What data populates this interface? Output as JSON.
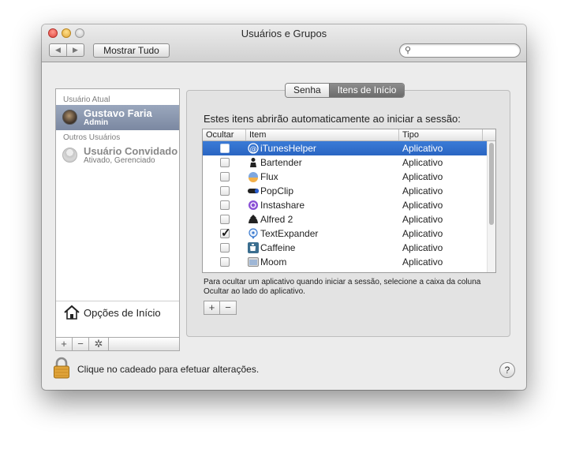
{
  "window": {
    "title": "Usuários e Grupos"
  },
  "toolbar": {
    "back_glyph": "◀",
    "forward_glyph": "▶",
    "show_all": "Mostrar Tudo",
    "search_placeholder": "",
    "search_icon": "magnifier-icon"
  },
  "sidebar": {
    "current_user_header": "Usuário Atual",
    "other_users_header": "Outros Usuários",
    "current_user": {
      "name": "Gustavo Faria",
      "role": "Admin",
      "selected": true
    },
    "guest_user": {
      "name": "Usuário Convidado",
      "status": "Ativado, Gerenciado"
    },
    "login_options": "Opções de Início",
    "tools": {
      "add": "+",
      "remove": "−",
      "action": "✲"
    }
  },
  "tabs": [
    {
      "label": "Senha",
      "active": false
    },
    {
      "label": "Itens de Início",
      "active": true
    }
  ],
  "panel": {
    "message": "Estes itens abrirão automaticamente ao iniciar a sessão:",
    "columns": {
      "hide": "Ocultar",
      "item": "Item",
      "type": "Tipo"
    },
    "rows": [
      {
        "name": "iTunesHelper",
        "type": "Aplicativo",
        "hidden": false,
        "selected": true,
        "icon": "itunes-helper-icon"
      },
      {
        "name": "Bartender",
        "type": "Aplicativo",
        "hidden": false,
        "selected": false,
        "icon": "bartender-icon"
      },
      {
        "name": "Flux",
        "type": "Aplicativo",
        "hidden": false,
        "selected": false,
        "icon": "flux-icon"
      },
      {
        "name": "PopClip",
        "type": "Aplicativo",
        "hidden": false,
        "selected": false,
        "icon": "popclip-icon"
      },
      {
        "name": "Instashare",
        "type": "Aplicativo",
        "hidden": false,
        "selected": false,
        "icon": "instashare-icon"
      },
      {
        "name": "Alfred 2",
        "type": "Aplicativo",
        "hidden": false,
        "selected": false,
        "icon": "alfred-icon"
      },
      {
        "name": "TextExpander",
        "type": "Aplicativo",
        "hidden": true,
        "selected": false,
        "icon": "textexpander-icon"
      },
      {
        "name": "Caffeine",
        "type": "Aplicativo",
        "hidden": false,
        "selected": false,
        "icon": "caffeine-icon"
      },
      {
        "name": "Moom",
        "type": "Aplicativo",
        "hidden": false,
        "selected": false,
        "icon": "moom-icon"
      }
    ],
    "note": "Para ocultar um aplicativo quando iniciar a sessão, selecione a caixa da coluna Ocultar ao lado do aplicativo.",
    "add": "+",
    "remove": "−"
  },
  "footer": {
    "lock_label": "Clique no cadeado para efetuar alterações.",
    "help": "?"
  },
  "colors": {
    "selection": "#3a7bd7",
    "sidebar_selection": "#8794ac"
  }
}
